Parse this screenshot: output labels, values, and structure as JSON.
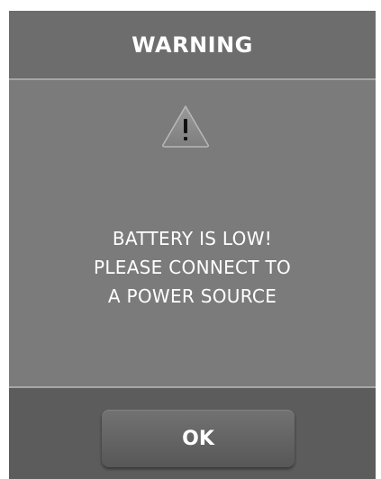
{
  "dialog": {
    "title": "WARNING",
    "icon": "warning-triangle-icon",
    "message_lines": [
      "BATTERY IS LOW!",
      "PLEASE CONNECT TO",
      "A POWER SOURCE"
    ],
    "ok_label": "OK"
  },
  "colors": {
    "header_bg": "#6d6d6d",
    "body_bg": "#7b7b7b",
    "footer_bg": "#5c5c5c",
    "divider": "#a6a6a6",
    "text": "#ffffff"
  }
}
